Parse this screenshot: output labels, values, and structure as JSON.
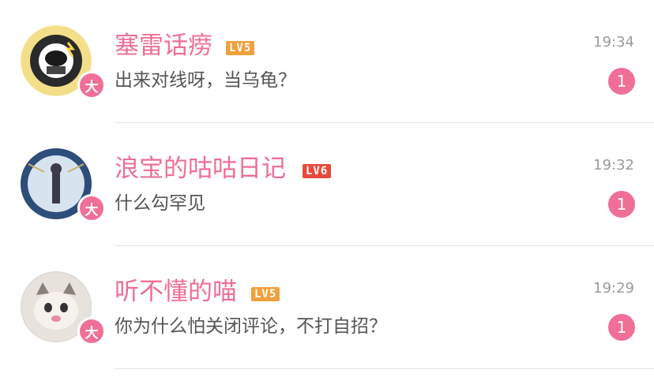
{
  "conversations": [
    {
      "name": "塞雷话痨",
      "level": "LV5",
      "badge": "大",
      "message": "出来对线呀，当乌龟？",
      "time": "19:34",
      "unread": "1"
    },
    {
      "name": "浪宝的咕咕日记",
      "level": "LV6",
      "badge": "大",
      "message": "什么勾罕见",
      "time": "19:32",
      "unread": "1"
    },
    {
      "name": "听不懂的喵",
      "level": "LV5",
      "badge": "大",
      "message": "你为什么怕关闭评论，不打自招？",
      "time": "19:29",
      "unread": "1"
    }
  ],
  "colors": {
    "accent": "#ee6f94",
    "lv5": "#f0a03c",
    "lv6": "#e94a3c"
  }
}
